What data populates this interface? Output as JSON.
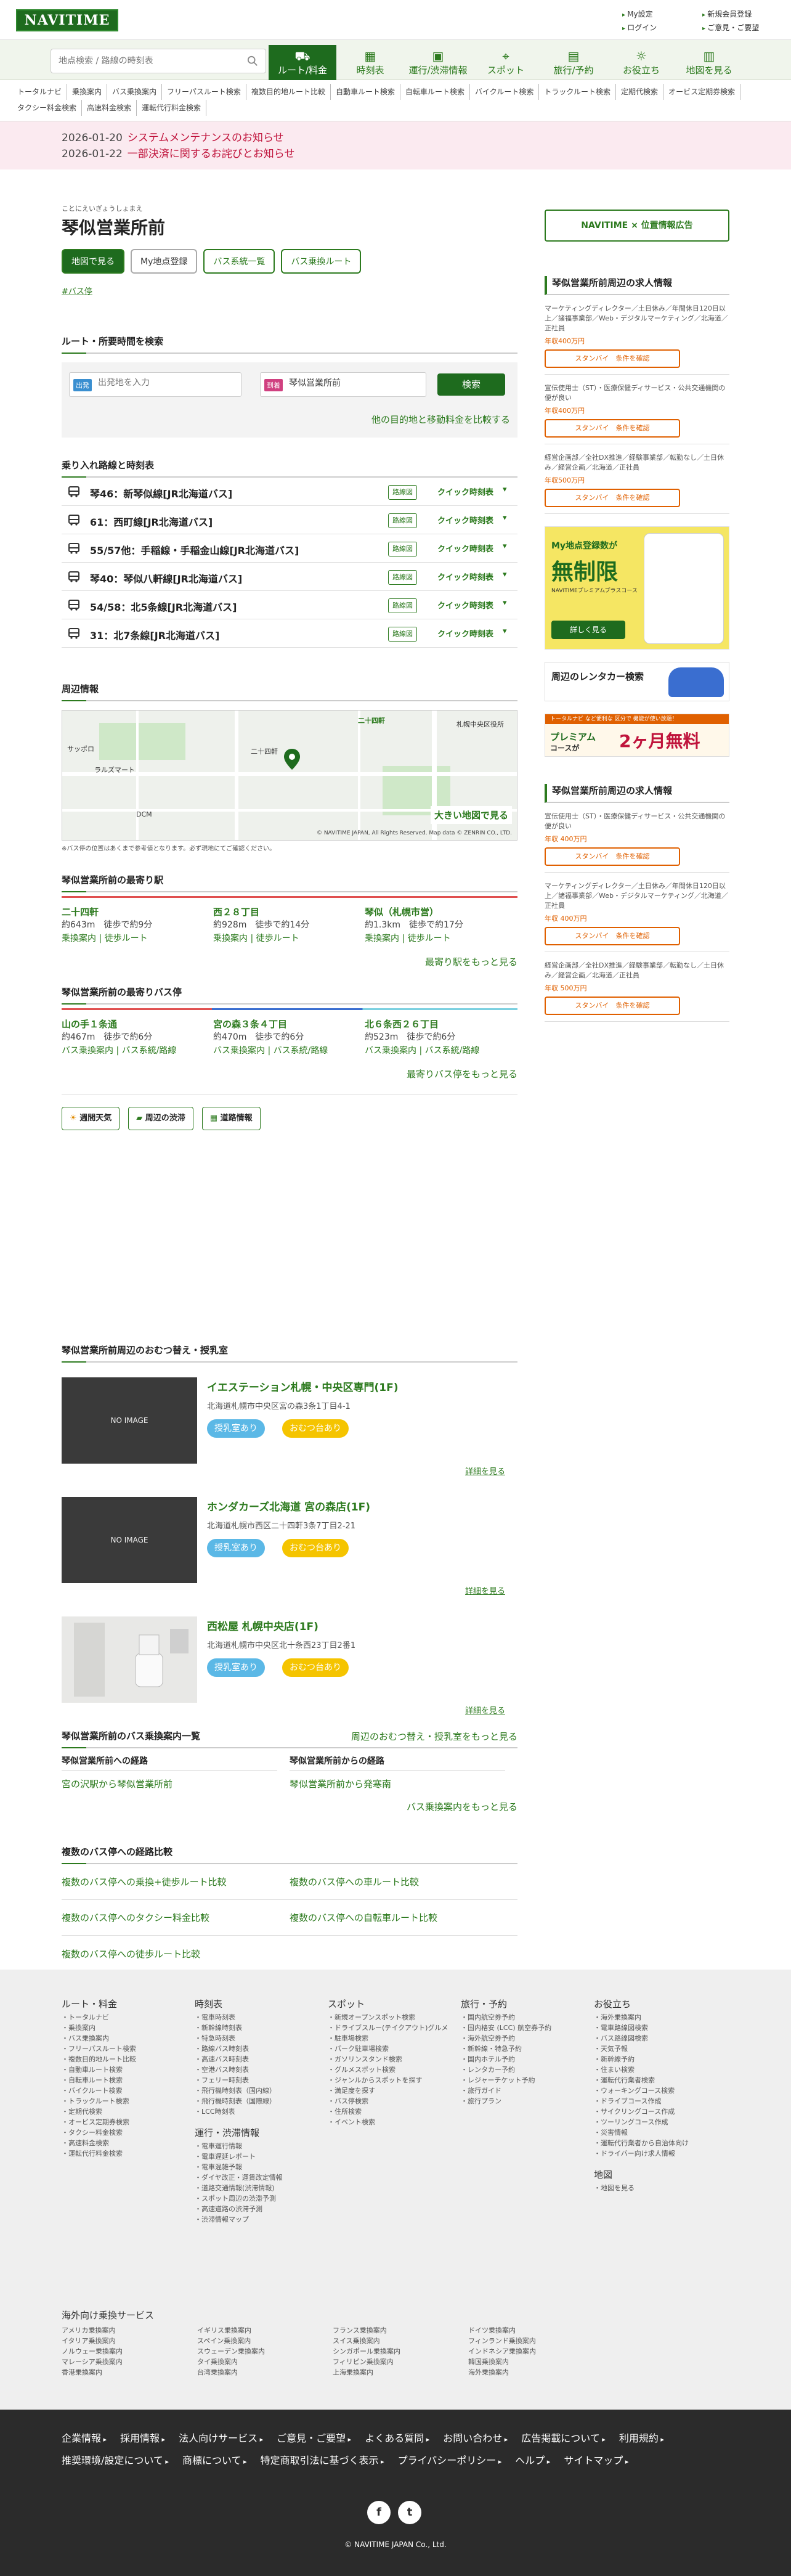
{
  "header": {
    "logo": "NAVITIME",
    "links": [
      "My設定",
      "新規会員登録",
      "ログイン",
      "ご意見・ご要望"
    ]
  },
  "search": {
    "placeholder": "地点検索 / 路線の時刻表"
  },
  "nav_tabs": [
    {
      "label": "ルート/料金",
      "icon": "bus-icon",
      "active": true
    },
    {
      "label": "時刻表",
      "icon": "calendar-icon"
    },
    {
      "label": "運行/渋滞情報",
      "icon": "traffic-icon"
    },
    {
      "label": "スポット",
      "icon": "pin-icon"
    },
    {
      "label": "旅行/予約",
      "icon": "suitcase-icon"
    },
    {
      "label": "お役立ち",
      "icon": "lightbulb-icon"
    },
    {
      "label": "地図を見る",
      "icon": "map-icon"
    }
  ],
  "subnav": [
    "トータルナビ",
    "乗換案内",
    "バス乗換案内",
    "フリーパスルート検索",
    "複数目的地ルート比較",
    "自動車ルート検索",
    "自転車ルート検索",
    "バイクルート検索",
    "トラックルート検索",
    "定期代検索",
    "オービス定期券検索",
    "タクシー料金検索",
    "高速料金検索",
    "運転代行料金検索"
  ],
  "notices": [
    {
      "date": "2026-01-20",
      "text": "システムメンテナンスのお知らせ"
    },
    {
      "date": "2026-01-22",
      "text": "一部決済に関するお詫びとお知らせ"
    }
  ],
  "page": {
    "ruby": "ことにえいぎょうしょまえ",
    "title": "琴似営業所前",
    "buttons": [
      "地図で見る",
      "My地点登録",
      "バス系統一覧",
      "バス乗換ルート"
    ],
    "tag": "#バス停"
  },
  "route": {
    "title": "ルート・所要時間を検索",
    "from_label": "出発",
    "from_placeholder": "出発地を入力",
    "to_label": "到着",
    "to_value": "琴似営業所前",
    "go": "検索",
    "compare": "他の目的地と移動料金を比較する"
  },
  "lines": {
    "title": "乗り入れ路線と時刻表",
    "map_label": "路線図",
    "tt_label": "クイック時刻表",
    "items": [
      "琴46：新琴似線[JR北海道バス]",
      "61：西町線[JR北海道バス]",
      "55/57他：手稲線・手稲金山線[JR北海道バス]",
      "琴40：琴似八軒線[JR北海道バス]",
      "54/58：北5条線[JR北海道バス]",
      "31：北7条線[JR北海道バス]"
    ]
  },
  "map_sec": {
    "title": "周辺情報",
    "big_map": "大きい地図で見る",
    "copyright": "© NAVITIME JAPAN, All Rights Reserved. Map data © ZENRIN CO., LTD.",
    "note": "※バス停の位置はあくまで参考値となります。必ず現地にてご確認ください。",
    "labels": [
      "二十四軒",
      "札幌中央区役所",
      "サッポロ",
      "ラルズマート",
      "DCM",
      "二十四軒"
    ]
  },
  "near_station": {
    "title": "琴似営業所前の最寄り駅",
    "items": [
      {
        "name": "二十四軒",
        "dist": "約643m　徒歩で約9分",
        "links": "乗換案内 | 徒歩ルート"
      },
      {
        "name": "西２８丁目",
        "dist": "約928m　徒歩で約14分",
        "links": "乗換案内 | 徒歩ルート"
      },
      {
        "name": "琴似（札幌市営）",
        "dist": "約1.3km　徒歩で約17分",
        "links": "乗換案内 | 徒歩ルート"
      }
    ],
    "more": "最寄り駅をもっと見る"
  },
  "near_bus": {
    "title": "琴似営業所前の最寄りバス停",
    "items": [
      {
        "name": "山の手１条通",
        "dist": "約467m　徒歩で約6分",
        "links": "バス乗換案内 | バス系統/路線"
      },
      {
        "name": "宮の森３条４丁目",
        "dist": "約470m　徒歩で約6分",
        "links": "バス乗換案内 | バス系統/路線"
      },
      {
        "name": "北６条西２６丁目",
        "dist": "約523m　徒歩で約6分",
        "links": "バス乗換案内 | バス系統/路線"
      }
    ],
    "more": "最寄りバス停をもっと見る"
  },
  "utils": [
    "週間天気",
    "周辺の渋滞",
    "道路情報"
  ],
  "baby": {
    "title": "琴似営業所前周辺のおむつ替え・授乳室",
    "no_image": "NO IMAGE",
    "pill_1": "授乳室あり",
    "pill_2": "おむつ台あり",
    "detail": "詳細を見る",
    "items": [
      {
        "name": "イエステーション札幌・中央区専門(1F)",
        "addr": "北海道札幌市中央区宮の森3条1丁目4-1"
      },
      {
        "name": "ホンダカーズ北海道 宮の森店(1F)",
        "addr": "北海道札幌市西区二十四軒3条7丁目2-21"
      },
      {
        "name": "西松屋 札幌中央店(1F)",
        "addr": "北海道札幌市中央区北十条西23丁目2番1"
      }
    ],
    "more": "周辺のおむつ替え・授乳室をもっと見る"
  },
  "transfer": {
    "title": "琴似営業所前のバス乗換案内一覧",
    "to_head": "琴似営業所前への経路",
    "from_head": "琴似営業所前からの経路",
    "to_link": "宮の沢駅から琴似営業所前",
    "from_link": "琴似営業所前から発寒南",
    "more": "バス乗換案内をもっと見る"
  },
  "compare": {
    "title": "複数のバス停への経路比較",
    "items": [
      "複数のバス停への乗換+徒歩ルート比較",
      "複数のバス停への車ルート比較",
      "複数のバス停へのタクシー料金比較",
      "複数のバス停への自転車ルート比較",
      "複数のバス停への徒歩ルート比較"
    ]
  },
  "footer": {
    "cols": [
      {
        "head": "ルート・料金",
        "items": [
          "トータルナビ",
          "乗換案内",
          "バス乗換案内",
          "フリーパスルート検索",
          "複数目的地ルート比較",
          "自動車ルート検索",
          "自転車ルート検索",
          "バイクルート検索",
          "トラックルート検索",
          "定期代検索",
          "オービス定期券検索",
          "タクシー料金検索",
          "高速料金検索",
          "運転代行料金検索"
        ]
      },
      {
        "head": "時刻表",
        "items": [
          "電車時刻表",
          "新幹線時刻表",
          "特急時刻表",
          "路線バス時刻表",
          "高速バス時刻表",
          "空港バス時刻表",
          "フェリー時刻表",
          "飛行機時刻表（国内線）",
          "飛行機時刻表（国際線）",
          "LCC時刻表"
        ],
        "head2": "運行・渋滞情報",
        "items2": [
          "電車運行情報",
          "電車遅延レポート",
          "電車混雑予報",
          "ダイヤ改正・運賃改定情報",
          "道路交通情報(渋滞情報)",
          "スポット周辺の渋滞予測",
          "高速道路の渋滞予測",
          "渋滞情報マップ"
        ]
      },
      {
        "head": "スポット",
        "items": [
          "新規オープンスポット検索",
          "ドライブスルー(テイクアウト)グルメ",
          "駐車場検索",
          "パーク駐車場検索",
          "ガソリンスタンド検索",
          "グルメスポット検索",
          "ジャンルからスポットを探す",
          "満足度を探す",
          "バス停検索",
          "住所検索",
          "イベント検索"
        ]
      },
      {
        "head": "旅行・予約",
        "items": [
          "国内航空券予約",
          "国内格安 (LCC) 航空券予約",
          "海外航空券予約",
          "新幹線・特急予約",
          "国内ホテル予約",
          "レンタカー予約",
          "レジャーチケット予約",
          "旅行ガイド",
          "旅行プラン"
        ]
      },
      {
        "head": "お役立ち",
        "items": [
          "海外乗換案内",
          "電車路線図検索",
          "バス路線図検索",
          "天気予報",
          "新幹線予約",
          "住まい検索",
          "運転代行業者検索",
          "ウォーキングコース検索",
          "ドライブコース作成",
          "サイクリングコース作成",
          "ツーリングコース作成",
          "災害情報",
          "運転代行業者から自治体向け",
          "ドライバー向け求人情報"
        ],
        "head2": "地図",
        "items2": [
          "地図を見る"
        ]
      }
    ],
    "overseas_head": "海外向け乗換サービス",
    "overseas": [
      [
        "アメリカ乗換案内",
        "イタリア乗換案内",
        "ノルウェー乗換案内",
        "マレーシア乗換案内",
        "香港乗換案内"
      ],
      [
        "イギリス乗換案内",
        "スペイン乗換案内",
        "スウェーデン乗換案内",
        "タイ乗換案内",
        "台湾乗換案内"
      ],
      [
        "フランス乗換案内",
        "スイス乗換案内",
        "シンガポール乗換案内",
        "フィリピン乗換案内",
        "上海乗換案内"
      ],
      [
        "ドイツ乗換案内",
        "フィンランド乗換案内",
        "インドネシア乗換案内",
        "韓国乗換案内",
        "海外乗換案内"
      ]
    ],
    "dark_links": [
      "企業情報",
      "採用情報",
      "法人向けサービス",
      "ご意見・ご要望",
      "よくある質問",
      "お問い合わせ",
      "広告掲載について",
      "利用規約",
      "推奨環境/設定について",
      "商標について",
      "特定商取引法に基づく表示",
      "プライバシーポリシー",
      "ヘルプ",
      "サイトマップ"
    ],
    "social": [
      "f",
      "t"
    ],
    "copyright": "© NAVITIME JAPAN Co., Ltd."
  },
  "side": {
    "location_ad": "NAVITIME × 位置情報広告",
    "jobs_title": "琴似営業所前周辺の求人情報",
    "job_btn": "スタンバイ　条件を確認",
    "jobs": [
      {
        "desc": "マーケティングディレクター／土日休み／年間休日120日以上／諸福事業部／Web・デジタルマーケティング／北海道／正社員",
        "salary": "年収400万円"
      },
      {
        "desc": "宣伝使用士（ST）・医療保健ディサービス・公共交通機関の便が良い",
        "salary": "年収400万円"
      },
      {
        "desc": "経営企画部／全社DX推進／経験事業部／転勤なし／土日休み／経営企画／北海道／正社員",
        "salary": "年収500万円"
      }
    ],
    "ad1_title": "My地点登録数が",
    "ad1_big": "無制限",
    "ad1_sub": "NAVITIMEプレミアムプラスコース",
    "ad1_btn": "詳しく見る",
    "ad2": "周辺のレンタカー検索",
    "ad3_top": "トータルナビ など便利な 区分で 機能が使い放題！",
    "ad3_a": "プレミアム",
    "ad3_b": "コースが",
    "ad3_c": "2ヶ月無料",
    "jobs2_title": "琴似営業所前周辺の求人情報",
    "jobs2": [
      {
        "desc": "宣伝使用士（ST）・医療保健ディサービス・公共交通機関の便が良い",
        "salary": "年収 400万円"
      },
      {
        "desc": "マーケティングディレクター／土日休み／年間休日120日以上／諸福事業部／Web・デジタルマーケティング／北海道／正社員",
        "salary": "年収 400万円"
      },
      {
        "desc": "経営企画部／全社DX推進／経験事業部／転勤なし／土日休み／経営企画／北海道／正社員",
        "salary": "年収 500万円"
      }
    ]
  },
  "colors": {
    "brand": "#1e6b1e",
    "link": "#2c7a1e",
    "notice": "#c0143c",
    "notice_bg": "#fbeaf0"
  }
}
